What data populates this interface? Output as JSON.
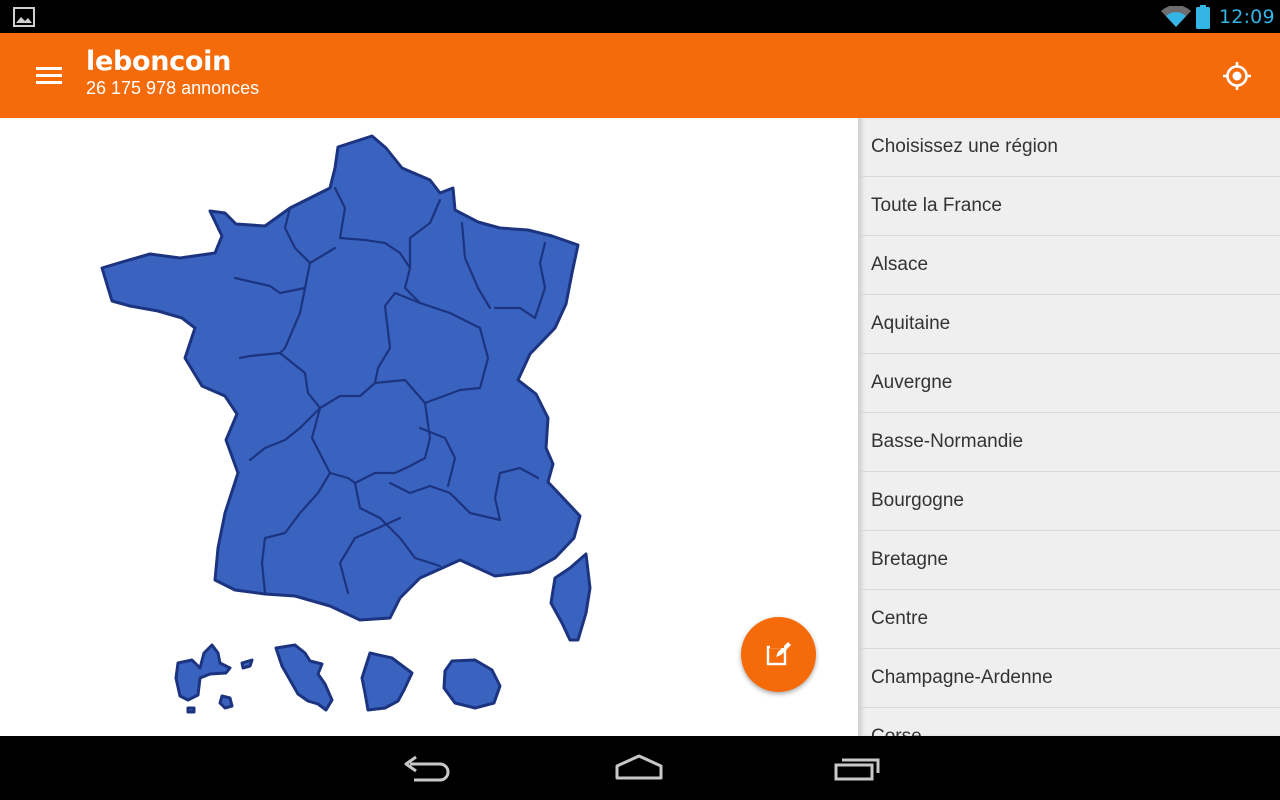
{
  "status_bar": {
    "time": "12:09",
    "left_icon": "gallery-icon",
    "right_icons": [
      "wifi-icon",
      "battery-icon"
    ],
    "clock_color": "#33b5e5"
  },
  "app_bar": {
    "brand": "leboncoin",
    "ad_count": "26 175 978 annonces",
    "menu_icon": "hamburger-menu-icon",
    "action_icon": "my-location-icon",
    "color": "#f56b0a"
  },
  "map": {
    "fill_color": "#3a63c0",
    "stroke_color": "#1c3480",
    "background": "#ffffff"
  },
  "fab": {
    "icon": "compose-icon",
    "color": "#f56b0a"
  },
  "region_list": {
    "header": "Choisissez une région",
    "items": [
      "Toute la France",
      "Alsace",
      "Aquitaine",
      "Auvergne",
      "Basse-Normandie",
      "Bourgogne",
      "Bretagne",
      "Centre",
      "Champagne-Ardenne",
      "Corse"
    ]
  },
  "nav_bar": {
    "buttons": [
      "back-icon",
      "home-icon",
      "recent-apps-icon"
    ]
  }
}
